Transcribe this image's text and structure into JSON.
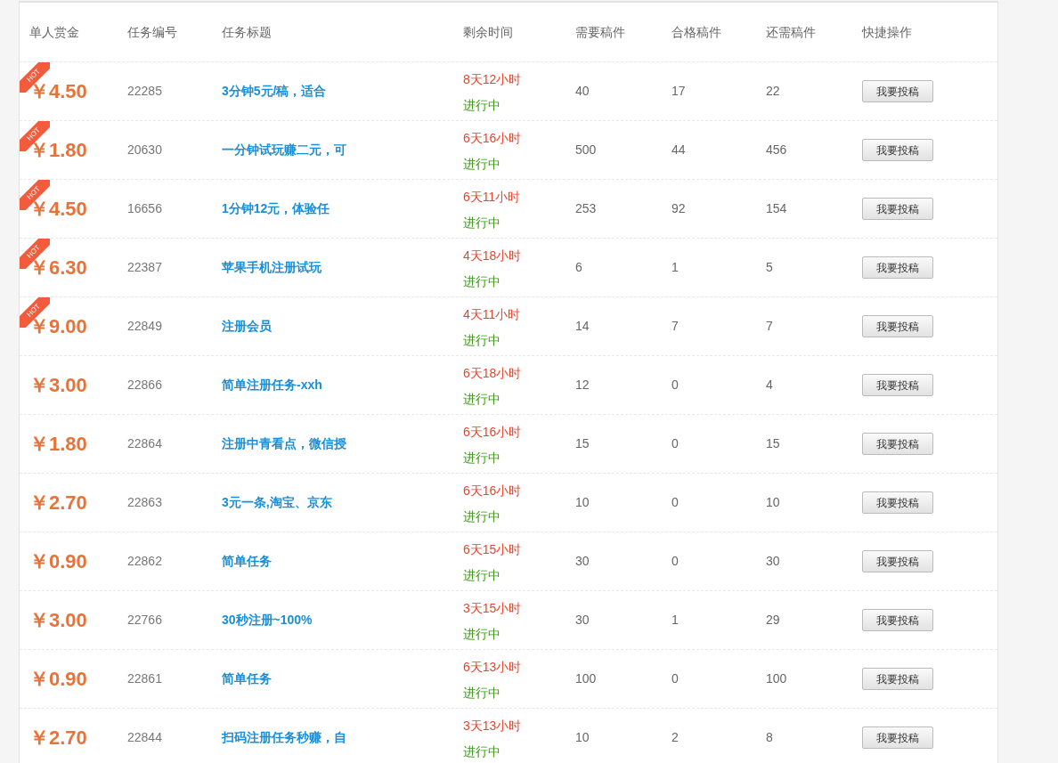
{
  "table": {
    "columns": [
      "单人赏金",
      "任务编号",
      "任务标题",
      "剩余时间",
      "需要稿件",
      "合格稿件",
      "还需稿件",
      "快捷操作"
    ],
    "rows": [
      {
        "badge": "HOT",
        "reward": "￥4.50",
        "id": "22285",
        "title": "3分钟5元/稿，适合",
        "remaining": "8天12小时",
        "status": "进行中",
        "needed": "40",
        "qualified": "17",
        "still_needed": "22",
        "action": "我要投稿"
      },
      {
        "badge": "HOT",
        "reward": "￥1.80",
        "id": "20630",
        "title": "一分钟试玩赚二元，可",
        "remaining": "6天16小时",
        "status": "进行中",
        "needed": "500",
        "qualified": "44",
        "still_needed": "456",
        "action": "我要投稿"
      },
      {
        "badge": "HOT",
        "reward": "￥4.50",
        "id": "16656",
        "title": "1分钟12元，体验任",
        "remaining": "6天11小时",
        "status": "进行中",
        "needed": "253",
        "qualified": "92",
        "still_needed": "154",
        "action": "我要投稿"
      },
      {
        "badge": "HOT",
        "reward": "￥6.30",
        "id": "22387",
        "title": "苹果手机注册试玩",
        "remaining": "4天18小时",
        "status": "进行中",
        "needed": "6",
        "qualified": "1",
        "still_needed": "5",
        "action": "我要投稿"
      },
      {
        "badge": "HOT",
        "reward": "￥9.00",
        "id": "22849",
        "title": "注册会员",
        "remaining": "4天11小时",
        "status": "进行中",
        "needed": "14",
        "qualified": "7",
        "still_needed": "7",
        "action": "我要投稿"
      },
      {
        "reward": "￥3.00",
        "id": "22866",
        "title": "简单注册任务-xxh",
        "remaining": "6天18小时",
        "status": "进行中",
        "needed": "12",
        "qualified": "0",
        "still_needed": "4",
        "action": "我要投稿"
      },
      {
        "reward": "￥1.80",
        "id": "22864",
        "title": "注册中青看点，微信授",
        "remaining": "6天16小时",
        "status": "进行中",
        "needed": "15",
        "qualified": "0",
        "still_needed": "15",
        "action": "我要投稿"
      },
      {
        "reward": "￥2.70",
        "id": "22863",
        "title": "3元一条,淘宝、京东",
        "remaining": "6天16小时",
        "status": "进行中",
        "needed": "10",
        "qualified": "0",
        "still_needed": "10",
        "action": "我要投稿"
      },
      {
        "reward": "￥0.90",
        "id": "22862",
        "title": "简单任务",
        "remaining": "6天15小时",
        "status": "进行中",
        "needed": "30",
        "qualified": "0",
        "still_needed": "30",
        "action": "我要投稿"
      },
      {
        "reward": "￥3.00",
        "id": "22766",
        "title": "30秒注册~100%",
        "remaining": "3天15小时",
        "status": "进行中",
        "needed": "30",
        "qualified": "1",
        "still_needed": "29",
        "action": "我要投稿"
      },
      {
        "reward": "￥0.90",
        "id": "22861",
        "title": "简单任务",
        "remaining": "6天13小时",
        "status": "进行中",
        "needed": "100",
        "qualified": "0",
        "still_needed": "100",
        "action": "我要投稿"
      },
      {
        "reward": "￥2.70",
        "id": "22844",
        "title": "扫码注册任务秒赚，自",
        "remaining": "3天13小时",
        "status": "进行中",
        "needed": "10",
        "qualified": "2",
        "still_needed": "8",
        "action": "我要投稿"
      }
    ]
  }
}
